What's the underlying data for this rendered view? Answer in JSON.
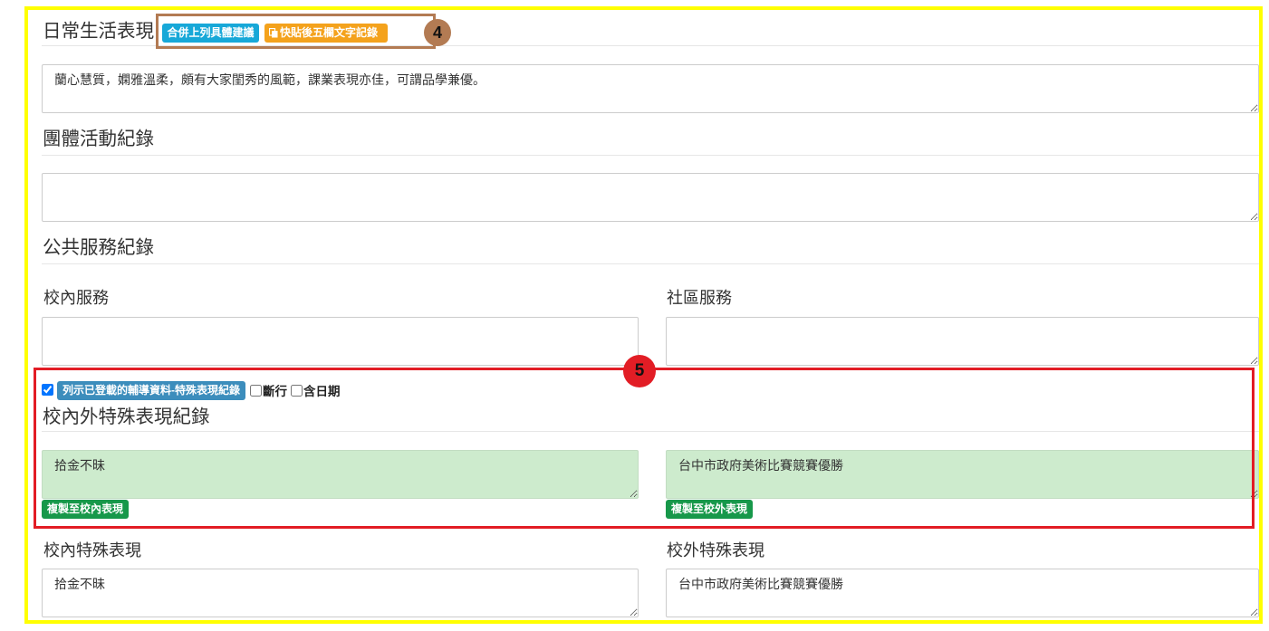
{
  "colors": {
    "highlight_frame": "#ffff00",
    "annotation_4": "#b37b53",
    "annotation_5": "#e21d25",
    "btn_merge": "#17a8d8",
    "btn_paste": "#f4a21c",
    "btn_list": "#3c8dbc",
    "btn_copy": "#17984a",
    "counsel_textarea_bg": "#cdebcd"
  },
  "icons": {
    "paste_button": "copy-icon"
  },
  "daily": {
    "heading": "日常生活表現",
    "btn_merge": "合併上列具體建議",
    "btn_paste": "快貼後五欄文字記錄",
    "badge": "4",
    "text": "蘭心慧質，嫻雅溫柔，頗有大家閨秀的風範，課業表現亦佳，可謂品學兼優。"
  },
  "group": {
    "heading": "團體活動紀錄",
    "text": ""
  },
  "service": {
    "heading": "公共服務紀錄",
    "school_label": "校內服務",
    "school_text": "",
    "community_label": "社區服務",
    "community_text": ""
  },
  "counsel": {
    "badge": "5",
    "list_checked": true,
    "list_button": "列示已登載的輔導資料-特殊表現紀錄",
    "linebreak_checked": false,
    "linebreak_label": "斷行",
    "date_checked": false,
    "date_label": "含日期",
    "heading": "校內外特殊表現紀錄",
    "inside_text": "拾金不昧",
    "outside_text": "台中市政府美術比賽競賽優勝",
    "copy_inside": "複製至校內表現",
    "copy_outside": "複製至校外表現"
  },
  "special": {
    "inside_label": "校內特殊表現",
    "inside_text": "拾金不昧",
    "outside_label": "校外特殊表現",
    "outside_text": "台中市政府美術比賽競賽優勝"
  }
}
